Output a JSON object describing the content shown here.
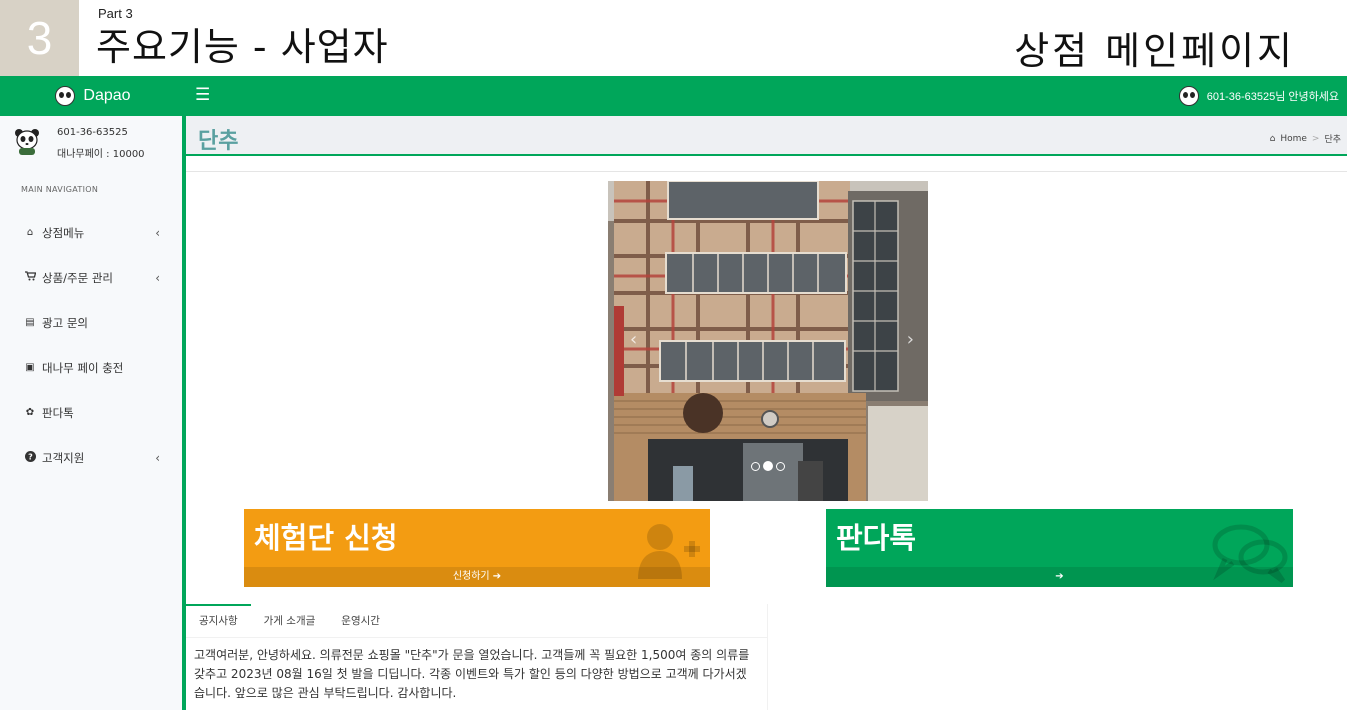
{
  "slide": {
    "number": "3",
    "part": "Part 3",
    "title": "주요기능 - 사업자",
    "right_title": "상점 메인페이지"
  },
  "navbar": {
    "brand": "Dapao",
    "menu_icon": "☰",
    "user_greeting": "601-36-63525님 안녕하세요"
  },
  "sidebar": {
    "user_id": "601-36-63525",
    "bamboo_pay": "대나무페이 : 10000",
    "nav_header": "MAIN NAVIGATION",
    "items": [
      {
        "label": "상점메뉴",
        "icon": "home-icon",
        "glyph": "⌂",
        "chevron": "‹"
      },
      {
        "label": "상품/주문 관리",
        "icon": "cart-icon",
        "glyph": "🛒",
        "chevron": "‹"
      },
      {
        "label": "광고 문의",
        "icon": "newspaper-icon",
        "glyph": "▤",
        "chevron": ""
      },
      {
        "label": "대나무 페이 충전",
        "icon": "money-icon",
        "glyph": "▣",
        "chevron": ""
      },
      {
        "label": "판다톡",
        "icon": "paw-icon",
        "glyph": "✿",
        "chevron": ""
      },
      {
        "label": "고객지원",
        "icon": "question-icon",
        "glyph": "?",
        "chevron": "‹"
      }
    ]
  },
  "content": {
    "page_title": "단추",
    "breadcrumb_home": "Home",
    "breadcrumb_sep": ">",
    "breadcrumb_current": "단추"
  },
  "carousel": {
    "prev": "‹",
    "next": "›",
    "slide_count": 3,
    "active_index": 1
  },
  "boxes": {
    "trial": {
      "title": "체험단 신청",
      "footer": "신청하기 ➔",
      "color": "#f39c12"
    },
    "pandatalk": {
      "title": "판다톡",
      "footer": "➔",
      "color": "#00a65a"
    }
  },
  "tabs": {
    "items": [
      "공지사항",
      "가게 소개글",
      "운영시간"
    ],
    "active": 0,
    "notice": "고객여러분, 안녕하세요. 의류전문 쇼핑몰 \"단추\"가 문을 열었습니다. 고객들께 꼭 필요한 1,500여 종의 의류를 갖추고 2023년 08월 16일 첫 발을 디딥니다. 각종 이벤트와 특가 할인 등의 다양한 방법으로 고객께 다가서겠습니다. 앞으로 많은 관심 부탁드립니다. 감사합니다."
  },
  "colors": {
    "primary_green": "#00a65a",
    "orange": "#f39c12",
    "title_teal": "#5aa0a0"
  }
}
